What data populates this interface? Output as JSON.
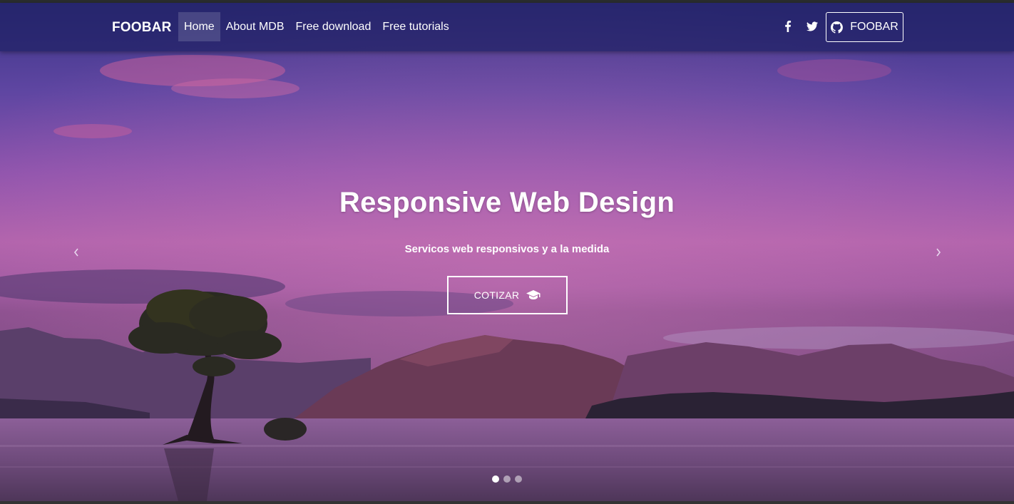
{
  "navbar": {
    "brand": "FOOBAR",
    "links": [
      {
        "label": "Home",
        "active": true
      },
      {
        "label": "About MDB",
        "active": false
      },
      {
        "label": "Free download",
        "active": false
      },
      {
        "label": "Free tutorials",
        "active": false
      }
    ],
    "social_icons": [
      "facebook-icon",
      "twitter-icon"
    ],
    "github_button_label": "FOOBAR"
  },
  "hero": {
    "title": "Responsive Web Design",
    "subtitle": "Servicos web responsivos y a la medida",
    "cta_label": "COTIZAR",
    "cta_icon": "graduation-cap-icon",
    "carousel": {
      "slide_count": 3,
      "active_index": 0
    }
  },
  "colors": {
    "navbar": "#1e2064",
    "accent": "#ffffff"
  }
}
